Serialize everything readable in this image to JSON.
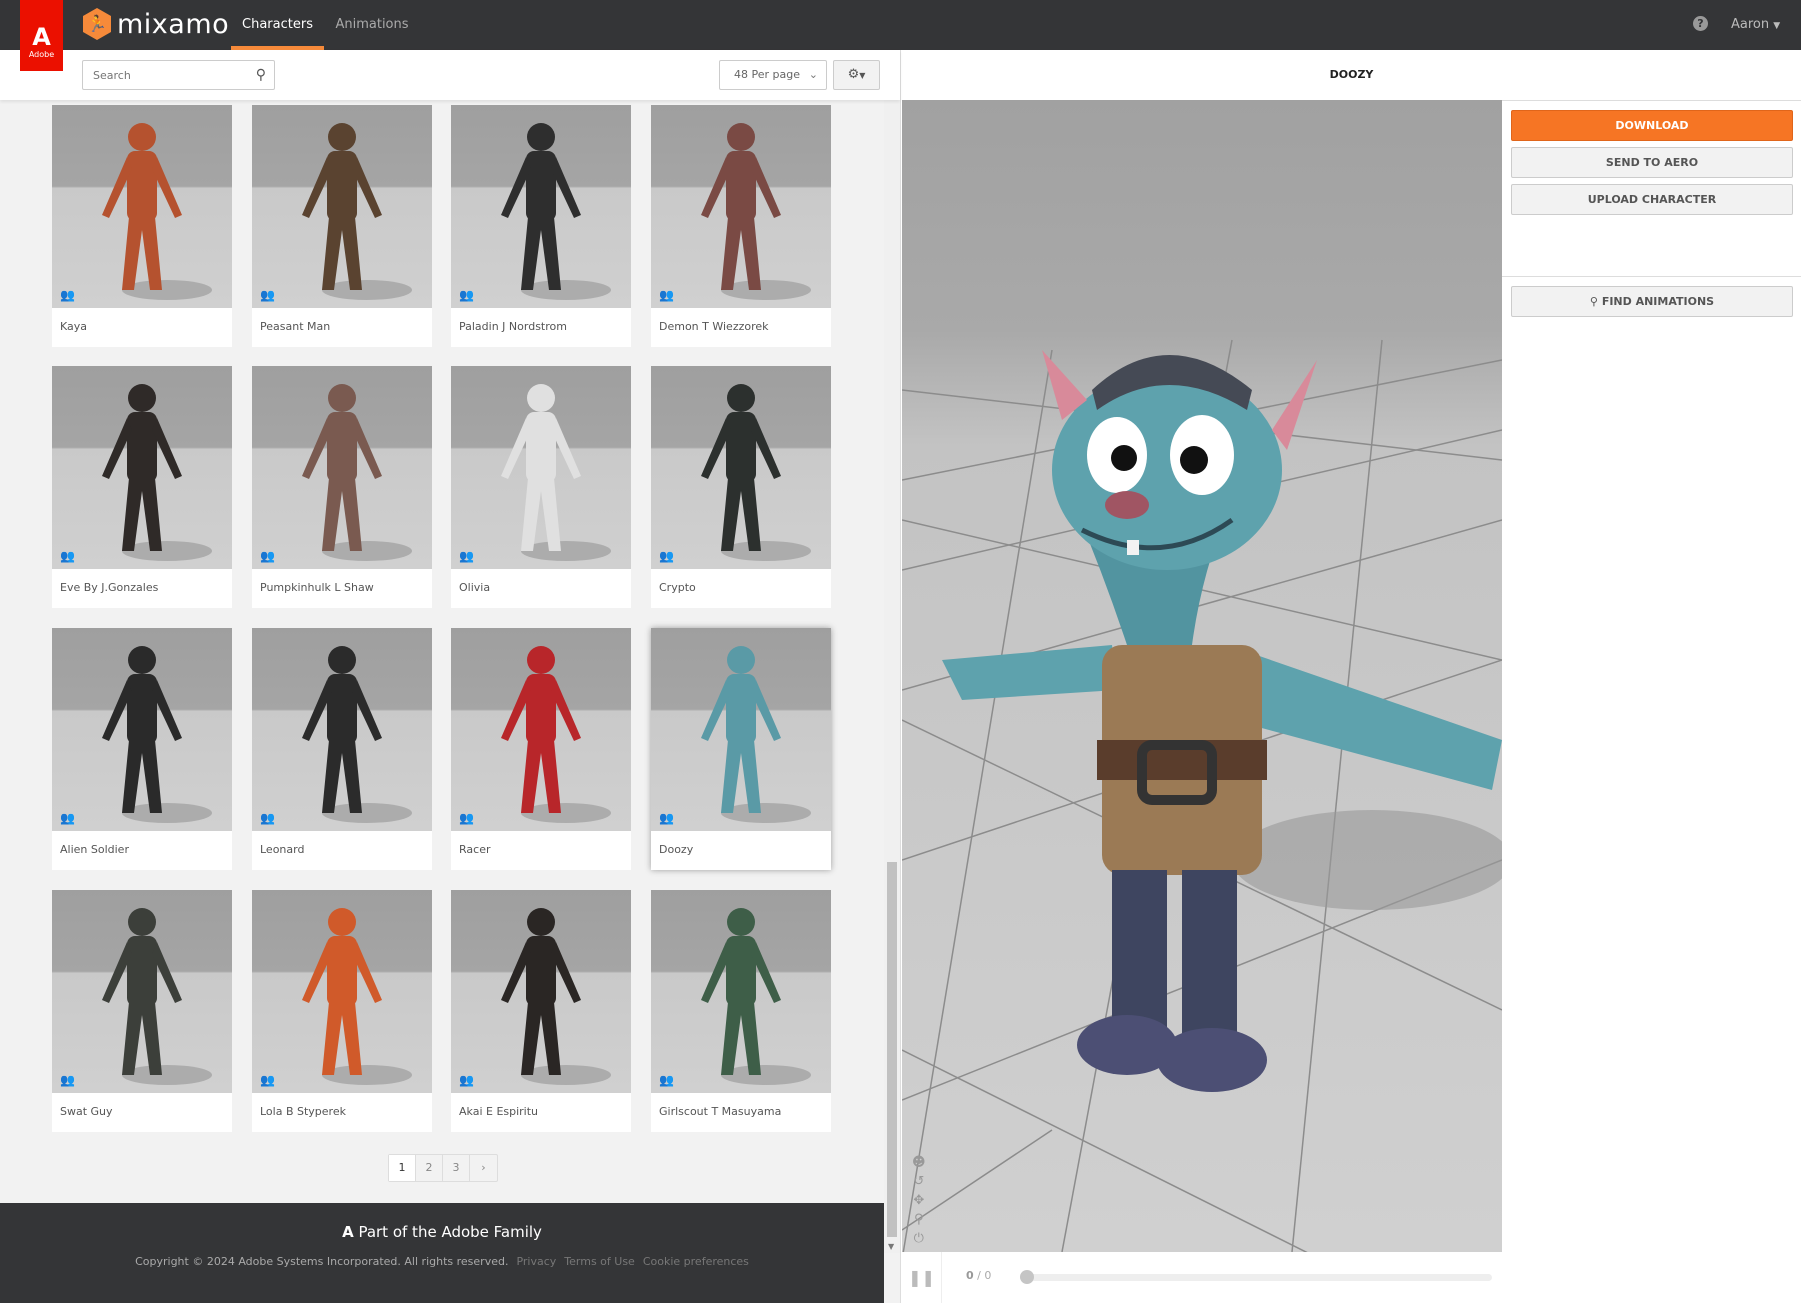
{
  "brand": {
    "adobe_label": "Adobe",
    "logo_text": "mixamo"
  },
  "nav": {
    "tabs": [
      {
        "label": "Characters",
        "active": true
      },
      {
        "label": "Animations",
        "active": false
      }
    ],
    "help_icon": "question-circle-icon",
    "user": "Aaron"
  },
  "toolbar": {
    "search_placeholder": "Search",
    "per_page": "48 Per page",
    "settings_icon": "gear-icon"
  },
  "characters": [
    {
      "name": "Kaya",
      "color": "#b5522f"
    },
    {
      "name": "Peasant Man",
      "color": "#5a4330"
    },
    {
      "name": "Paladin J Nordstrom",
      "color": "#2e2e2e"
    },
    {
      "name": "Demon T Wiezzorek",
      "color": "#7a4a44"
    },
    {
      "name": "Eve By J.Gonzales",
      "color": "#2f2a28"
    },
    {
      "name": "Pumpkinhulk L Shaw",
      "color": "#7a5a50"
    },
    {
      "name": "Olivia",
      "color": "#e0e0e0"
    },
    {
      "name": "Crypto",
      "color": "#2c302e"
    },
    {
      "name": "Alien Soldier",
      "color": "#2a2a2a"
    },
    {
      "name": "Leonard",
      "color": "#2b2b2b"
    },
    {
      "name": "Racer",
      "color": "#b8262a"
    },
    {
      "name": "Doozy",
      "color": "#5a9aa6",
      "selected": true
    },
    {
      "name": "Swat Guy",
      "color": "#3c3f3a"
    },
    {
      "name": "Lola B Styperek",
      "color": "#d05a2a"
    },
    {
      "name": "Akai E Espiritu",
      "color": "#2a2624"
    },
    {
      "name": "Girlscout T Masuyama",
      "color": "#3e5e48"
    }
  ],
  "pagination": {
    "pages": [
      "1",
      "2",
      "3"
    ],
    "current": "1",
    "next": "›"
  },
  "footer": {
    "family": "Part of the Adobe Family",
    "copyright": "Copyright © 2024 Adobe Systems Incorporated. All rights reserved.",
    "links": [
      "Privacy",
      "Terms of Use",
      "Cookie preferences"
    ]
  },
  "viewer": {
    "title": "DOOZY",
    "frame_current": "0",
    "frame_total": "0",
    "progress": 0
  },
  "actions": {
    "download": "DOWNLOAD",
    "send_to_aero": "SEND TO AERO",
    "upload": "UPLOAD CHARACTER",
    "find_animations": "FIND ANIMATIONS"
  },
  "colors": {
    "accent": "#f67524",
    "topbar": "#343537",
    "adobe_red": "#eb1000"
  }
}
